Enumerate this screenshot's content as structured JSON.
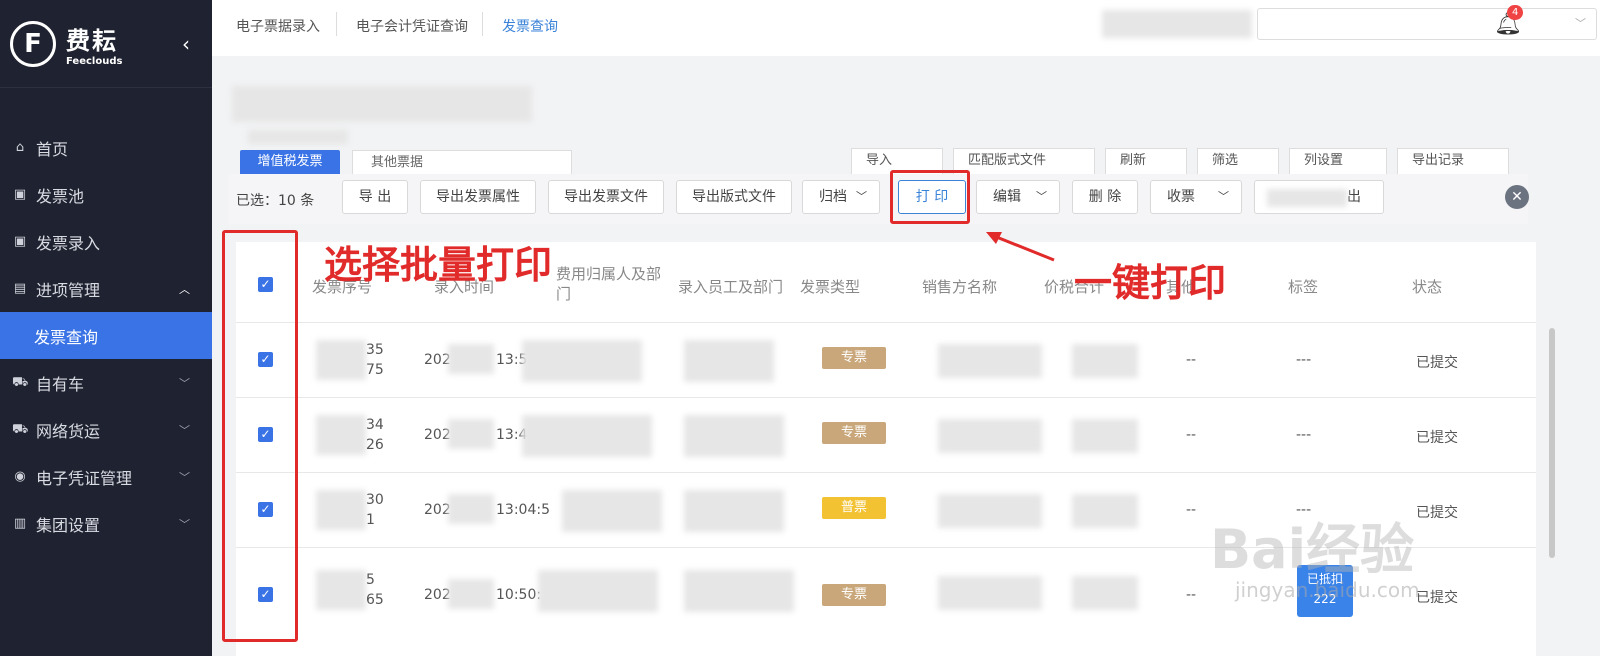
{
  "logo": {
    "mark": "F",
    "name_cn": "费耘",
    "name_en": "Feeclouds"
  },
  "sidebar": {
    "items": [
      {
        "label": "首页",
        "icon": "home-icon",
        "glyph": "⌂"
      },
      {
        "label": "发票池",
        "icon": "folder-icon",
        "glyph": "▣"
      },
      {
        "label": "发票录入",
        "icon": "folder-icon",
        "glyph": "▣"
      },
      {
        "label": "进项管理",
        "icon": "folder-open-icon",
        "glyph": "▤",
        "expanded": true
      },
      {
        "label": "发票查询",
        "sub": true
      },
      {
        "label": "自有车",
        "icon": "car-icon",
        "glyph": "⛟"
      },
      {
        "label": "网络货运",
        "icon": "truck-icon",
        "glyph": "⛟"
      },
      {
        "label": "电子凭证管理",
        "icon": "voucher-icon",
        "glyph": "◉"
      },
      {
        "label": "集团设置",
        "icon": "building-icon",
        "glyph": "▥"
      }
    ]
  },
  "topbar": {
    "tabs": [
      "电子票据录入",
      "电子会计凭证查询",
      "发票查询"
    ],
    "active_tab": "发票查询",
    "notification_count": "4"
  },
  "subtabs": {
    "primary": "增值税发票",
    "other": "其他票据"
  },
  "toolbar_top": [
    "导入",
    "匹配版式文件",
    "刷新",
    "筛选",
    "列设置",
    "导出记录"
  ],
  "actionbar": {
    "selected": "已选：10 条",
    "buttons": [
      "导 出",
      "导出发票属性",
      "导出发票文件",
      "导出版式文件",
      "归档",
      "打 印",
      "编辑",
      "删 除",
      "收票"
    ],
    "last_button_tail": "出"
  },
  "table": {
    "headers": [
      "发票序号",
      "录入时间",
      "费用归属人及部门",
      "录入员工及部门",
      "发票类型",
      "销售方名称",
      "价税合计",
      "其他",
      "标签",
      "状态"
    ],
    "rows": [
      {
        "seq_top": "35",
        "seq_bottom": "75",
        "date_prefix": "202",
        "time": "13:5",
        "type": "专票",
        "tail1": "--",
        "tag": "---",
        "status": "已提交"
      },
      {
        "seq_top": "34",
        "seq_bottom": "26",
        "date_prefix": "202",
        "time": "13:4",
        "type": "专票",
        "tail1": "--",
        "tag": "---",
        "status": "已提交"
      },
      {
        "seq_top": "30",
        "seq_bottom": "1",
        "date_prefix": "202",
        "time": "13:04:5",
        "type": "普票",
        "tail1": "--",
        "tag": "---",
        "status": "已提交"
      },
      {
        "seq_top": "5",
        "seq_bottom": "65",
        "date_prefix": "202",
        "time": "10:50:",
        "type": "专票",
        "tail1": "--",
        "tag": "",
        "status": "已提交",
        "deduct_label": "已抵扣",
        "deduct_num": "222"
      }
    ]
  },
  "annotations": {
    "left": "选择批量打印",
    "right": "一键打印"
  },
  "watermark": {
    "main": "Bai经验",
    "sub": "jingyan.baidu.com"
  }
}
